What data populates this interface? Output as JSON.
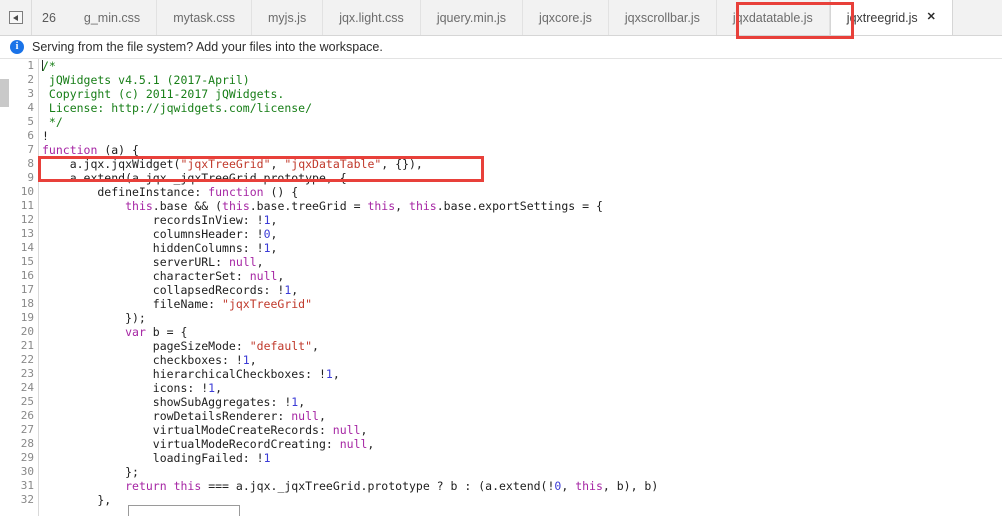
{
  "tabbar": {
    "scroll_icon": "scroll-left-icon",
    "count": "26",
    "tabs": [
      {
        "label": "g_min.css",
        "active": false,
        "closable": false
      },
      {
        "label": "mytask.css",
        "active": false,
        "closable": false
      },
      {
        "label": "myjs.js",
        "active": false,
        "closable": false
      },
      {
        "label": "jqx.light.css",
        "active": false,
        "closable": false
      },
      {
        "label": "jquery.min.js",
        "active": false,
        "closable": false
      },
      {
        "label": "jqxcore.js",
        "active": false,
        "closable": false
      },
      {
        "label": "jqxscrollbar.js",
        "active": false,
        "closable": false
      },
      {
        "label": "jqxdatatable.js",
        "active": false,
        "closable": false
      },
      {
        "label": "jqxtreegrid.js",
        "active": true,
        "closable": true
      }
    ],
    "close_glyph": "✕"
  },
  "infobar": {
    "icon": "info-icon",
    "icon_glyph": "i",
    "message": "Serving from the file system? Add your files into the workspace."
  },
  "editor": {
    "first_line_number": 1,
    "last_line_number": 32,
    "line_numbers": [
      "1",
      "2",
      "3",
      "4",
      "5",
      "6",
      "7",
      "8",
      "9",
      "10",
      "11",
      "12",
      "13",
      "14",
      "15",
      "16",
      "17",
      "18",
      "19",
      "20",
      "21",
      "22",
      "23",
      "24",
      "25",
      "26",
      "27",
      "28",
      "29",
      "30",
      "31",
      "32"
    ],
    "lines": [
      "/*",
      " jQWidgets v4.5.1 (2017-April)",
      " Copyright (c) 2011-2017 jQWidgets.",
      " License: http://jqwidgets.com/license/",
      " */",
      "!",
      "function (a) {",
      "    a.jqx.jqxWidget(\"jqxTreeGrid\", \"jqxDataTable\", {}),",
      "    a.extend(a.jqx._jqxTreeGrid.prototype, {",
      "        defineInstance: function () {",
      "            this.base && (this.base.treeGrid = this, this.base.exportSettings = {",
      "                recordsInView: !1,",
      "                columnsHeader: !0,",
      "                hiddenColumns: !1,",
      "                serverURL: null,",
      "                characterSet: null,",
      "                collapsedRecords: !1,",
      "                fileName: \"jqxTreeGrid\"",
      "            });",
      "            var b = {",
      "                pageSizeMode: \"default\",",
      "                checkboxes: !1,",
      "                hierarchicalCheckboxes: !1,",
      "                icons: !1,",
      "                showSubAggregates: !1,",
      "                rowDetailsRenderer: null,",
      "                virtualModeCreateRecords: null,",
      "                virtualModeRecordCreating: null,",
      "                loadingFailed: !1",
      "            };",
      "            return this === a.jqx._jqxTreeGrid.prototype ? b : (a.extend(!0, this, b), b)",
      "        },"
    ]
  },
  "annotations": {
    "color": "#e8403a",
    "boxes": [
      {
        "name": "tab-highlight",
        "target": "jqxtreegrid.js tab"
      },
      {
        "name": "code-highlight",
        "target": "line 8 jqxWidget call"
      }
    ]
  },
  "autocomplete": {
    "visible": true,
    "label": ""
  }
}
